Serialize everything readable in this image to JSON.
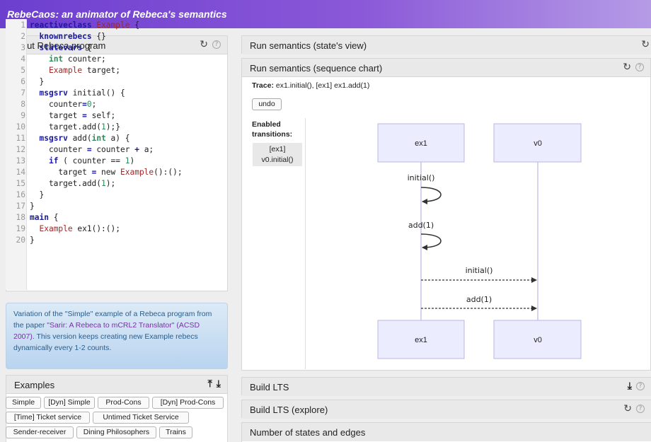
{
  "app": {
    "title": "RebeCaos: an animator of Rebeca's semantics"
  },
  "input_panel": {
    "title": "Input Rebeca program"
  },
  "code_lines": [
    {
      "n": "1"
    },
    {
      "n": "2"
    },
    {
      "n": "3"
    },
    {
      "n": "4"
    },
    {
      "n": "5"
    },
    {
      "n": "6"
    },
    {
      "n": "7"
    },
    {
      "n": "8"
    },
    {
      "n": "9"
    },
    {
      "n": "10"
    },
    {
      "n": "11"
    },
    {
      "n": "12"
    },
    {
      "n": "13"
    },
    {
      "n": "14"
    },
    {
      "n": "15"
    },
    {
      "n": "16"
    },
    {
      "n": "17"
    },
    {
      "n": "18"
    },
    {
      "n": "19"
    },
    {
      "n": "20"
    }
  ],
  "code_tokens": {
    "l1": [
      "reactiveclass",
      " Example",
      " {"
    ],
    "l2": [
      "  ",
      "knownrebecs",
      " {}"
    ],
    "l3": [
      "  ",
      "statevars",
      " {"
    ],
    "l4": [
      "    ",
      "int",
      " counter;"
    ],
    "l5": [
      "    ",
      "Example",
      " target;"
    ],
    "l6": [
      "  }"
    ],
    "l7": [
      "  ",
      "msgsrv",
      " initial() {"
    ],
    "l8": [
      "    counter",
      "=",
      "0",
      ";"
    ],
    "l9": [
      "    target ",
      "=",
      " self;"
    ],
    "l10": [
      "    target.add(",
      "1",
      ");}"
    ],
    "l11": [
      "  ",
      "msgsrv",
      " add(",
      "int",
      " a) {"
    ],
    "l12": [
      "    counter ",
      "=",
      " counter ",
      "+",
      " a;"
    ],
    "l13": [
      "    ",
      "if",
      " ( counter == ",
      "1",
      ")"
    ],
    "l14": [
      "      target ",
      "=",
      " new ",
      "Example",
      "():();"
    ],
    "l15": [
      "    target.add(",
      "1",
      ");"
    ],
    "l16": [
      "  }"
    ],
    "l17": [
      "}"
    ],
    "l18": [
      "main",
      " {"
    ],
    "l19": [
      "  ",
      "Example",
      " ex1():();"
    ],
    "l20": [
      "}"
    ]
  },
  "description": {
    "part1": "Variation of the \"Simple\" example of a Rebeca program from the paper ",
    "link": "\"Sarir: A Rebeca to mCRL2 Translator\" (ACSD 2007)",
    "part2": ". This version keeps creating new Example rebecs dynamically every 1-2 counts."
  },
  "examples_panel": {
    "title": "Examples"
  },
  "examples": [
    "Simple",
    "[Dyn] Simple",
    "Prod-Cons",
    "[Dyn] Prod-Cons",
    "[Time] Ticket service",
    "Untimed Ticket Service",
    "Sender-receiver",
    "Dining Philosophers",
    "Trains"
  ],
  "right_panels": {
    "state_view": "Run semantics (state's view)",
    "seq_chart": "Run semantics (sequence chart)",
    "build_lts": "Build LTS",
    "build_lts_explore": "Build LTS (explore)",
    "states_edges": "Number of states and edges"
  },
  "seq": {
    "trace_label": "Trace:",
    "trace_value": "ex1.initial(), [ex1] ex1.add(1)",
    "undo": "undo",
    "enabled_label": "Enabled transitions:",
    "enabled_item_line1": "[ex1]",
    "enabled_item_line2": "v0.initial()",
    "actors": [
      "ex1",
      "v0"
    ],
    "self_messages": [
      "initial()",
      "add(1)"
    ],
    "messages": [
      "initial()",
      "add(1)"
    ]
  },
  "colors": {
    "accent": "#6d3fcf",
    "actor_fill": "#ececff",
    "actor_stroke": "#b9b9e0"
  }
}
